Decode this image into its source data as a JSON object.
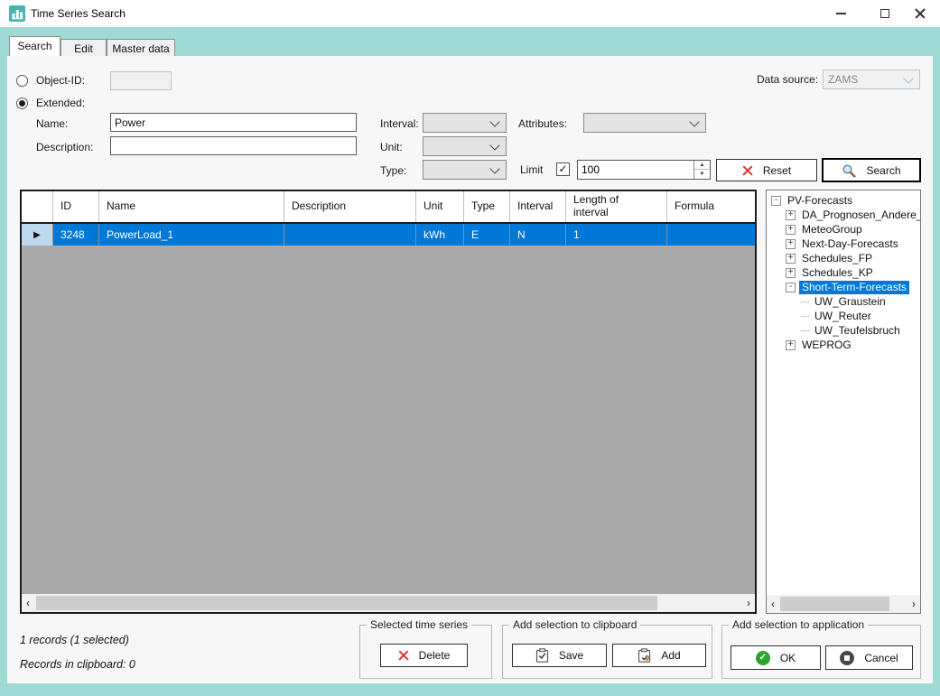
{
  "window": {
    "title": "Time Series Search"
  },
  "tabs": {
    "search": "Search",
    "edit": "Edit",
    "master": "Master data"
  },
  "form": {
    "object_id_label": "Object-ID:",
    "extended_label": "Extended:",
    "name_label": "Name:",
    "name_value": "Power",
    "description_label": "Description:",
    "description_value": "",
    "interval_label": "Interval:",
    "unit_label": "Unit:",
    "type_label": "Type:",
    "attributes_label": "Attributes:",
    "limit_label": "Limit",
    "limit_value": "100",
    "data_source_label": "Data source:",
    "data_source_value": "ZAMS",
    "reset_label": "Reset",
    "search_label": "Search"
  },
  "table": {
    "headers": [
      "ID",
      "Name",
      "Description",
      "Unit",
      "Type",
      "Interval",
      "Length of interval",
      "Formula"
    ],
    "rows": [
      {
        "id": "3248",
        "name": "PowerLoad_1",
        "description": "",
        "unit": "kWh",
        "type": "E",
        "interval": "N",
        "length_of_interval": "1",
        "formula": ""
      }
    ]
  },
  "tree": {
    "items": [
      {
        "label": "PV-Forecasts",
        "sign": "-"
      },
      {
        "label": "DA_Prognosen_Andere_",
        "sign": "+"
      },
      {
        "label": "MeteoGroup",
        "sign": "+"
      },
      {
        "label": "Next-Day-Forecasts",
        "sign": "+"
      },
      {
        "label": "Schedules_FP",
        "sign": "+"
      },
      {
        "label": "Schedules_KP",
        "sign": "+"
      },
      {
        "label": "Short-Term-Forecasts",
        "sign": "-"
      },
      {
        "label": "UW_Graustein",
        "sign": ""
      },
      {
        "label": "UW_Reuter",
        "sign": ""
      },
      {
        "label": "UW_Teufelsbruch",
        "sign": ""
      },
      {
        "label": "WEPROG",
        "sign": "+"
      }
    ]
  },
  "status": {
    "records": "1 records (1 selected)",
    "clipboard": "Records in clipboard: 0"
  },
  "groups": {
    "selected": {
      "label": "Selected time series",
      "delete_label": "Delete"
    },
    "clipboard": {
      "label": "Add selection to clipboard",
      "save_label": "Save",
      "add_label": "Add"
    },
    "application": {
      "label": "Add selection to application",
      "ok_label": "OK",
      "cancel_label": "Cancel"
    }
  },
  "icons": {
    "check": "✓",
    "row_arrow": "▶",
    "spin_up": "▲",
    "spin_down": "▼",
    "scroll_left": "‹",
    "scroll_right": "›"
  },
  "colors": {
    "accent_blue": "#0078d7",
    "frame_teal": "#9fdad5",
    "app_icon_teal": "#45b5ad",
    "grid_gray": "#a9a9a9",
    "error_red": "#d9342b",
    "ok_green": "#2fa32f"
  }
}
